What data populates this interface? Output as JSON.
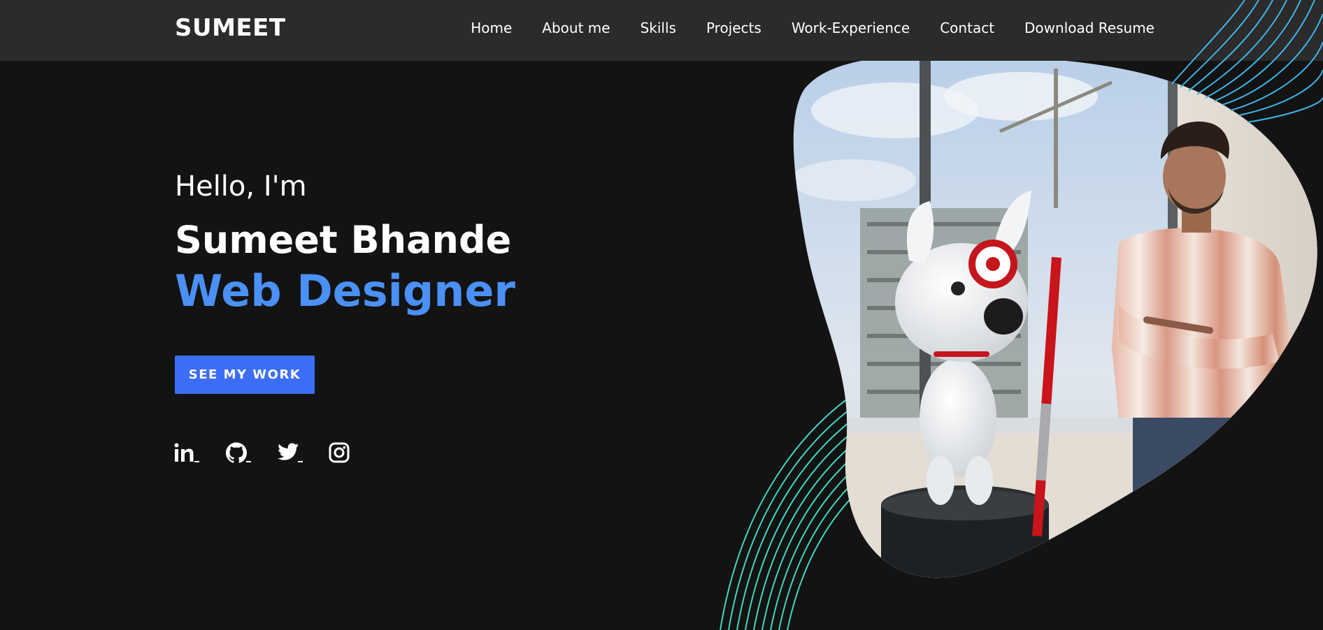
{
  "header": {
    "logo": "SUMEET",
    "nav": [
      {
        "label": "Home"
      },
      {
        "label": "About me"
      },
      {
        "label": "Skills"
      },
      {
        "label": "Projects"
      },
      {
        "label": "Work-Experience"
      },
      {
        "label": "Contact"
      },
      {
        "label": "Download Resume"
      }
    ]
  },
  "hero": {
    "greeting": "Hello, I'm",
    "name": "Sumeet Bhande",
    "role": "Web Designer",
    "cta_label": "SEE MY WORK"
  },
  "socials": [
    {
      "icon": "linkedin-icon"
    },
    {
      "icon": "github-icon"
    },
    {
      "icon": "twitter-icon"
    },
    {
      "icon": "instagram-icon"
    }
  ],
  "colors": {
    "background": "#131313",
    "header": "#2b2b2b",
    "accent_blue": "#4a90f5",
    "button": "#3c6ef5",
    "arc_top": "#3fb6e8",
    "arc_bottom": "#3fd8c0"
  }
}
